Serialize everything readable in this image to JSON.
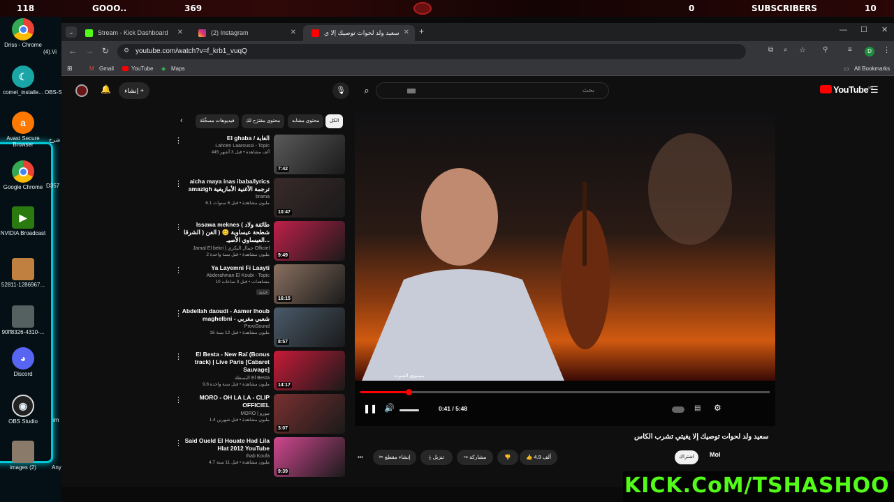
{
  "overlay": {
    "left_count": "118",
    "goal_text": "GOOO..",
    "center_count": "369",
    "zero_count": "0",
    "subs_label": "SUBSCRIBERS",
    "subs_count": "10"
  },
  "desktop": {
    "icons": [
      {
        "label": "Driss - Chrome",
        "icon": "chrome-icon"
      },
      {
        "label": "comet_installe...",
        "icon": "comet-icon"
      },
      {
        "label": "Avast Secure Browser",
        "icon": "avast-icon"
      },
      {
        "label": "Google Chrome",
        "icon": "chrome-icon"
      },
      {
        "label": "NVIDIA Broadcast",
        "icon": "nvidia-icon"
      },
      {
        "label": "52811-1286967...",
        "icon": "image-icon"
      },
      {
        "label": "90ff8326-4310-...",
        "icon": "image-icon"
      },
      {
        "label": "Discord",
        "icon": "discord-icon"
      },
      {
        "label": "OBS Studio",
        "icon": "obs-icon"
      },
      {
        "label": "images (2)",
        "icon": "image-icon"
      }
    ],
    "partial_labels": [
      "(4).Vi",
      "OBS-S",
      "شرح",
      "D357",
      "im",
      "Any"
    ]
  },
  "browser": {
    "tabs": [
      {
        "title": "Stream - Kick Dashboard",
        "color": "#53fc18"
      },
      {
        "title": "(2) Instagram",
        "color": "#e1306c"
      },
      {
        "title": "سعيد ولد لحوات توصيك إلا ي",
        "color": "#ff0000"
      }
    ],
    "url": "youtube.com/watch?v=f_krb1_vuqQ",
    "bookmarks": [
      "Gmail",
      "YouTube",
      "Maps"
    ],
    "all_bookmarks": "All Bookmarks",
    "profile_initial": "D"
  },
  "youtube": {
    "create_label": "إنشاء",
    "search_placeholder": "بحث",
    "logo_text": "YouTube",
    "logo_region": "MA",
    "chips": [
      "الكل",
      "محتوى مشابه",
      "محتوى مقترَح لك",
      "فيديوهات مسجَّلة"
    ],
    "recommended": [
      {
        "title": "El ghaba / الغابة",
        "channel": "Lahcen Laaroussi - Topic",
        "stats": "445 ألف مشاهدة • قبل 3 أشهر",
        "duration": "7:42",
        "thumb": "#5a5a5a"
      },
      {
        "title": "aicha maya inas ibaba/lyrics amazigh ترجمة الأغنية الأمازيغية",
        "channel": "brama",
        "stats": "6.1 مليون مشاهدة • قبل 6 سنوات",
        "duration": "10:47",
        "thumb": "#3a2a2a"
      },
      {
        "title": "Issawa meknes ( طائفة ولاد الشرقا ) شطحة عيساوية 😊 ( الفن العيساوي الأصيـ...",
        "channel": "Jamal El bekri | جمال البكري Officiel",
        "stats": "2 مليون مشاهدة • قبل سنة واحدة",
        "duration": "9:49",
        "thumb": "#c0204a"
      },
      {
        "title": "Ya Layemni Fi Laayti",
        "channel": "Abderahman El Koubi - Topic",
        "stats": "10 مشاهدات • قبل 3 ساعات",
        "badge": "جديد",
        "duration": "16:15",
        "thumb": "#8a7060"
      },
      {
        "title": "Abdellah daoudi - Aamer lhoub maghelbni - شعبي مغربي",
        "channel": "ProviSound",
        "stats": "16 مليون مشاهدة • قبل 12 سنة",
        "duration": "8:57",
        "thumb": "#4a5a6a"
      },
      {
        "title": "El Besta - New Raï (Bonus track) | Live Paris [Cabaret Sauvage]",
        "channel": "البسطة El Besta",
        "stats": "9.8 مليون مشاهدة • قبل سنة واحدة",
        "duration": "14:17",
        "thumb": "#c81a38"
      },
      {
        "title": "MORO - OH LA LA - CLIP OFFICIEL",
        "channel": "MORO | مورو",
        "stats": "1.4 مليون مشاهدة • قبل شهرين",
        "duration": "3:07",
        "thumb": "#7a3030"
      },
      {
        "title": "Said Oueld El Houate  Had Lila Hlat 2012  YouTube",
        "channel": "Ihab Koufa",
        "stats": "4.7 مليون مشاهدة • قبل 11 سنة",
        "duration": "9:39",
        "thumb": "#d04890"
      }
    ],
    "player": {
      "volume_tooltip": "مستوى الصوت",
      "time": "0:41 / 5:48",
      "progress": 0.118
    },
    "video_title": "سعيد ولد لحوات توصيك إلا يغيتي تشرب الكاس",
    "channel_initial": "Mol",
    "subscribe_label": "اشتراك",
    "actions": {
      "likes": "4.9 ألف",
      "share": "مشاركة",
      "download": "تنزيل",
      "clip": "إنشاء مقطع"
    }
  },
  "kick_banner": "KICK.CoM/TSHASHOO"
}
